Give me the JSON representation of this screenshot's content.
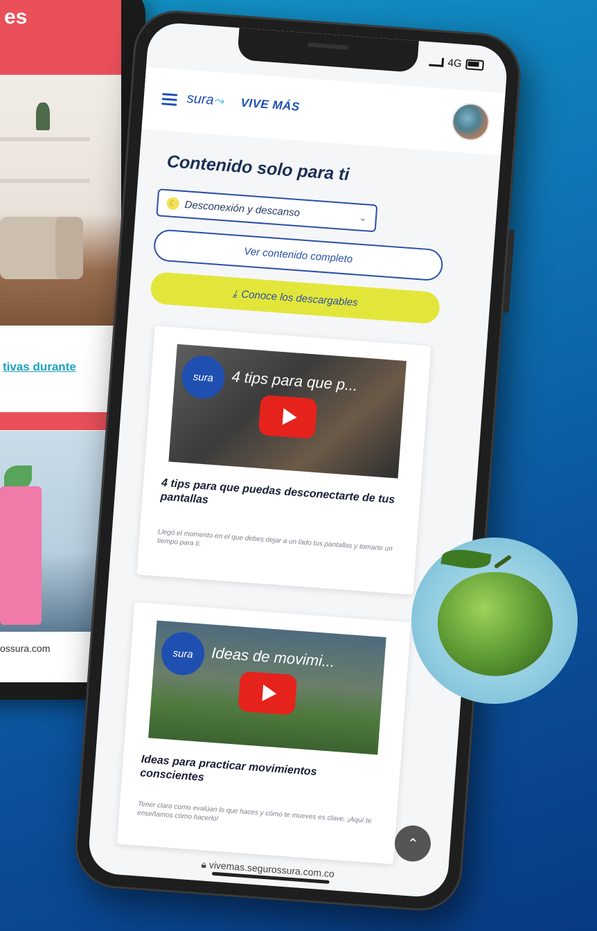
{
  "back_phone": {
    "title_fragment": "es",
    "link_fragment": "tivas durante",
    "url_fragment": "ossura.com"
  },
  "status_bar": {
    "network": "4G"
  },
  "header": {
    "logo": "sura",
    "brand": "VIVE MÁS"
  },
  "main": {
    "section_title": "Contenido solo para ti",
    "dropdown": {
      "selected": "Desconexión y descanso"
    },
    "view_full_button": "Ver contenido completo",
    "downloads_button": "Conoce los descargables",
    "cards": [
      {
        "thumb_logo": "sura",
        "thumb_title": "4 tips para que p...",
        "title": "4 tips para que puedas desconectarte de tus pantallas",
        "description": "Llegó el momento en el que debes dejar a un lado tus pantallas y tomarte un tiempo para ti."
      },
      {
        "thumb_logo": "sura",
        "thumb_title": "Ideas de movimi...",
        "title": "Ideas para practicar movimientos conscientes",
        "description": "Tener claro como evalúan lo que haces y cómo te mueves es clave. ¡Aquí te enseñamos cómo hacerlo!"
      }
    ]
  },
  "url_bar": {
    "url": "vivemas.segurossura.com.co"
  },
  "colors": {
    "brand_blue": "#2a4ea8",
    "accent_yellow": "#e3e63a",
    "background_blue": "#0e74b4"
  }
}
